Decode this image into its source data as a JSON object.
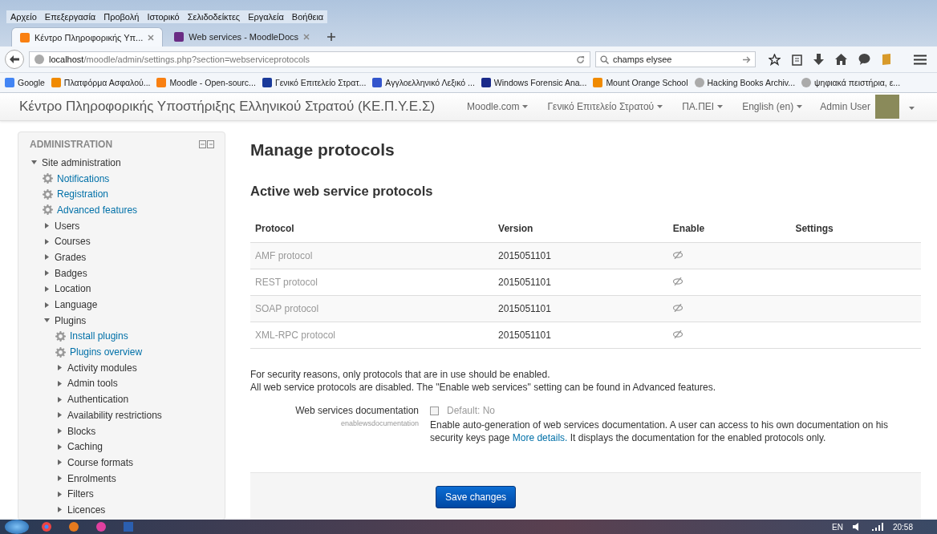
{
  "menu_bar": [
    "Αρχείο",
    "Επεξεργασία",
    "Προβολή",
    "Ιστορικό",
    "Σελιδοδείκτες",
    "Εργαλεία",
    "Βοήθεια"
  ],
  "tabs": [
    {
      "label": "Κέντρο Πληροφορικής Υπ...",
      "selected": true
    },
    {
      "label": "Web services - MoodleDocs",
      "selected": false
    }
  ],
  "address_bar": {
    "host": "localhost",
    "path": "/moodle/admin/settings.php?section=webserviceprotocols"
  },
  "search": {
    "value": "champs elysee"
  },
  "bookmarks": [
    "Google",
    "Πλατφόρμα Ασφαλού...",
    "Moodle - Open-sourc...",
    "Γενικό Επιτελείο Στρατ...",
    "Αγγλοελληνικό Λεξικό ...",
    "Windows Forensic Ana...",
    "Mount Orange School",
    "Hacking Books Archiv...",
    "ψηφιακά πειστήρια, ε..."
  ],
  "site_header": {
    "title": "Κέντρο Πληροφορικής Υποστήριξης Ελληνικού Στρατού (ΚΕ.Π.Υ.Ε.Σ)",
    "menus": [
      "Moodle.com",
      "Γενικό Επιτελείο Στρατού",
      "ΠΑ.ΠΕΙ",
      "English (en)"
    ],
    "user": "Admin User"
  },
  "sidebar": {
    "title": "ADMINISTRATION",
    "items": [
      {
        "label": "Site administration",
        "kind": "category",
        "expanded": true,
        "children": [
          {
            "label": "Notifications",
            "kind": "page"
          },
          {
            "label": "Registration",
            "kind": "page"
          },
          {
            "label": "Advanced features",
            "kind": "page"
          },
          {
            "label": "Users",
            "kind": "category",
            "expanded": false
          },
          {
            "label": "Courses",
            "kind": "category",
            "expanded": false
          },
          {
            "label": "Grades",
            "kind": "category",
            "expanded": false
          },
          {
            "label": "Badges",
            "kind": "category",
            "expanded": false
          },
          {
            "label": "Location",
            "kind": "category",
            "expanded": false
          },
          {
            "label": "Language",
            "kind": "category",
            "expanded": false
          },
          {
            "label": "Plugins",
            "kind": "category",
            "expanded": true,
            "children": [
              {
                "label": "Install plugins",
                "kind": "page"
              },
              {
                "label": "Plugins overview",
                "kind": "page"
              },
              {
                "label": "Activity modules",
                "kind": "category",
                "expanded": false
              },
              {
                "label": "Admin tools",
                "kind": "category",
                "expanded": false
              },
              {
                "label": "Authentication",
                "kind": "category",
                "expanded": false
              },
              {
                "label": "Availability restrictions",
                "kind": "category",
                "expanded": false
              },
              {
                "label": "Blocks",
                "kind": "category",
                "expanded": false
              },
              {
                "label": "Caching",
                "kind": "category",
                "expanded": false
              },
              {
                "label": "Course formats",
                "kind": "category",
                "expanded": false
              },
              {
                "label": "Enrolments",
                "kind": "category",
                "expanded": false
              },
              {
                "label": "Filters",
                "kind": "category",
                "expanded": false
              },
              {
                "label": "Licences",
                "kind": "category",
                "expanded": false
              }
            ]
          }
        ]
      }
    ]
  },
  "page_title": "Manage protocols",
  "section_title": "Active web service protocols",
  "table": {
    "columns": [
      "Protocol",
      "Version",
      "Enable",
      "Settings"
    ],
    "rows": [
      {
        "protocol": "AMF protocol",
        "version": "2015051101",
        "enabled": false
      },
      {
        "protocol": "REST protocol",
        "version": "2015051101",
        "enabled": false
      },
      {
        "protocol": "SOAP protocol",
        "version": "2015051101",
        "enabled": false
      },
      {
        "protocol": "XML-RPC protocol",
        "version": "2015051101",
        "enabled": false
      }
    ]
  },
  "notes": [
    "For security reasons, only protocols that are in use should be enabled.",
    "All web service protocols are disabled. The \"Enable web services\" setting can be found in Advanced features."
  ],
  "setting": {
    "label": "Web services documentation",
    "name": "enablewsdocumentation",
    "checked": false,
    "default": "Default: No",
    "description": "Enable auto-generation of web services documentation. A user can access to his own documentation on his security keys page",
    "link": "More details.",
    "description_end": "It displays the documentation for the enabled protocols only."
  },
  "save_button": "Save changes",
  "taskbar": {
    "language": "EN",
    "time": "20:58"
  }
}
